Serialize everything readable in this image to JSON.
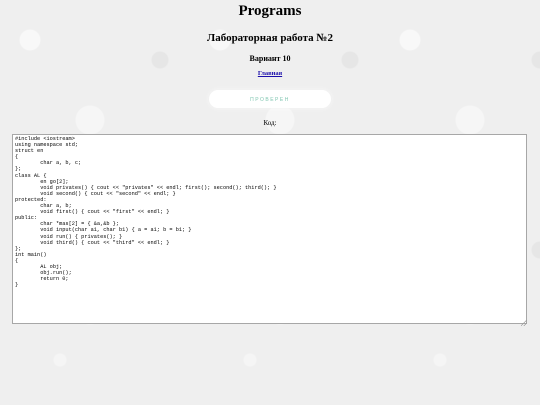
{
  "header": {
    "title": "Programs",
    "lab_title": "Лабораторная работа №2",
    "variant": "Вариант 10"
  },
  "nav": {
    "home_link": "Главная"
  },
  "actions": {
    "check_label": "ПРОВЕРЕН"
  },
  "editor": {
    "label": "Код:",
    "code": "#include <iostream>\nusing namespace std;\nstruct en\n{\n\tchar a, b, c;\n};\nclass AL {\n\ten go[2];\n\tvoid privates() { cout << \"privates\" << endl; first(); second(); third(); }\n\tvoid second() { cout << \"second\" << endl; }\nprotected:\n\tchar a, b;\n\tvoid first() { cout << \"first\" << endl; }\npublic:\n\tchar *mas[2] = { &a,&b };\n\tvoid input(char a1, char b1) { a = a1; b = b1; }\n\tvoid run() { privates(); }\n\tvoid third() { cout << \"third\" << endl; }\n};\nint main()\n{\n\tAL obj;\n\tobj.run();\n\treturn 0;\n}"
  }
}
